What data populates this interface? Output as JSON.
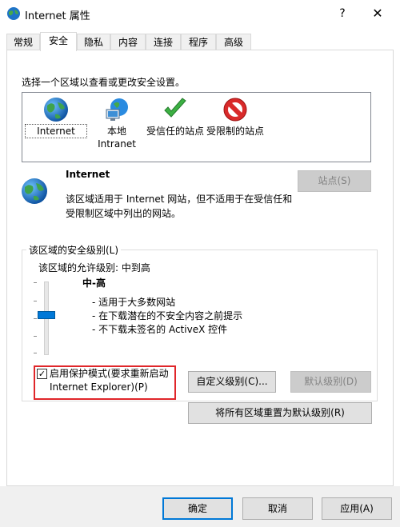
{
  "window": {
    "title": "Internet 属性",
    "help_glyph": "?",
    "close_glyph": "✕"
  },
  "tabs": [
    {
      "label": "常规"
    },
    {
      "label": "安全"
    },
    {
      "label": "隐私"
    },
    {
      "label": "内容"
    },
    {
      "label": "连接"
    },
    {
      "label": "程序"
    },
    {
      "label": "高级"
    }
  ],
  "security": {
    "zone_prompt": "选择一个区域以查看或更改安全设置。",
    "zones": [
      {
        "label": "Internet",
        "icon": "globe-icon",
        "selected": true
      },
      {
        "label": "本地\nIntranet",
        "icon": "intranet-icon",
        "selected": false
      },
      {
        "label": "受信任的站点",
        "icon": "check-icon",
        "selected": false
      },
      {
        "label": "受限制的站点",
        "icon": "restricted-icon",
        "selected": false
      }
    ],
    "detail": {
      "title": "Internet",
      "description": "该区域适用于 Internet 网站，但不适用于在受信任和受限制区域中列出的网站。",
      "sites_button": "站点(S)"
    },
    "level_group": {
      "legend": "该区域的安全级别(L)",
      "allowed_level": "该区域的允许级别: 中到高",
      "level_name": "中-高",
      "level_items": [
        "- 适用于大多数网站",
        "- 在下载潜在的不安全内容之前提示",
        "- 不下载未签名的 ActiveX 控件"
      ],
      "slider_level_fraction": 0.5
    },
    "protected_mode": {
      "checked": true,
      "label": "启用保护模式(要求重新启动 Internet Explorer)(P)"
    },
    "custom_level_button": "自定义级别(C)...",
    "default_level_button": "默认级别(D)",
    "reset_all_button": "将所有区域重置为默认级别(R)"
  },
  "footer": {
    "ok": "确定",
    "cancel": "取消",
    "apply": "应用(A)"
  },
  "colors": {
    "accent": "#0078d7",
    "highlight_red": "#e0262a"
  }
}
